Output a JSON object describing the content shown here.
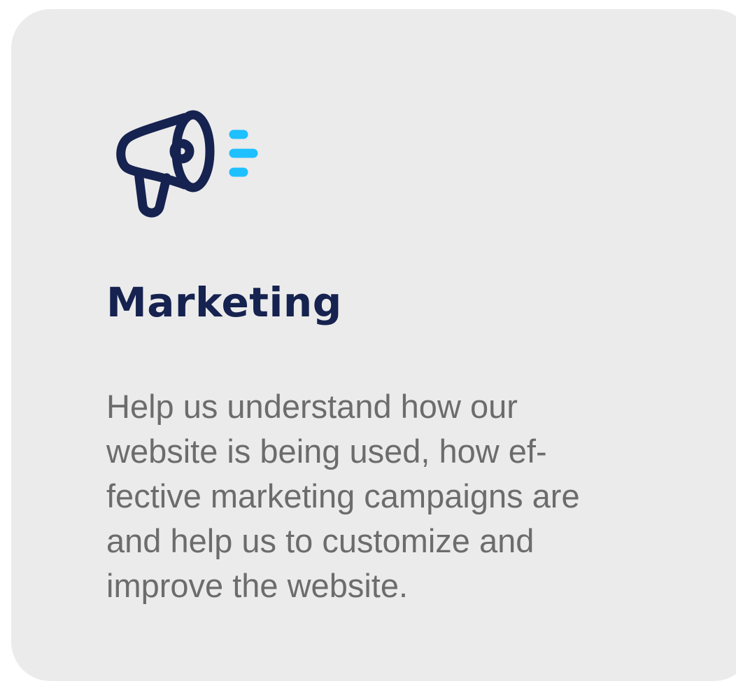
{
  "card": {
    "icon": "megaphone-icon",
    "title": "Marketing",
    "description_lines": [
      "Help us understand how our",
      "website is being used, how ef-",
      "fective marketing campaigns are",
      "and help us to customize and",
      "improve the website."
    ]
  },
  "colors": {
    "card_background": "#ebebeb",
    "title": "#16224f",
    "description": "#6c6c6c",
    "icon_primary": "#16224f",
    "icon_accent": "#1ec0ff"
  }
}
